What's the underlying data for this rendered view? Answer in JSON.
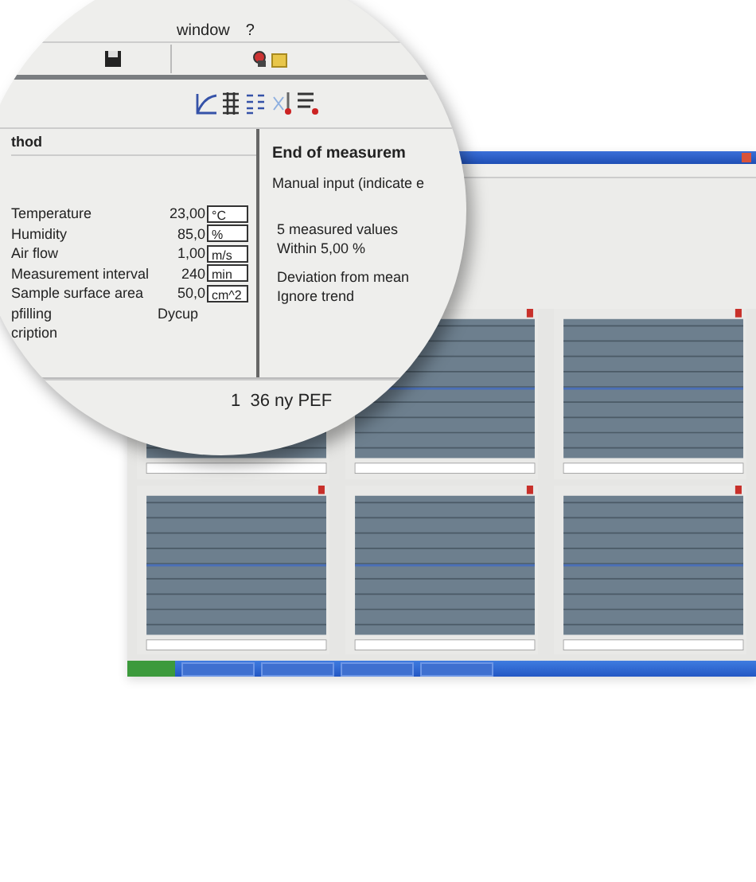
{
  "menu": [
    "window",
    "?"
  ],
  "method_panel": {
    "title": "thod",
    "rows": [
      {
        "label": "Temperature",
        "value": "23,00",
        "unit": "°C"
      },
      {
        "label": "Humidity",
        "value": "85,0",
        "unit": "%"
      },
      {
        "label": "Air flow",
        "value": "1,00",
        "unit": "m/s"
      },
      {
        "label": "Measurement interval",
        "value": "240",
        "unit": "min"
      },
      {
        "label": "Sample surface area",
        "value": "50,0",
        "unit": "cm^2"
      }
    ],
    "extra_rows": [
      {
        "label": "pfilling",
        "value": "Dycup"
      },
      {
        "label": "cription",
        "value": ""
      }
    ]
  },
  "end_panel": {
    "title": "End of measurem",
    "subtitle": "Manual input (indicate e",
    "lines": [
      "5 measured values",
      "Within 5,00 %",
      "Deviation from mean",
      "Ignore trend"
    ]
  },
  "status_text": "1  36 ny PEF"
}
